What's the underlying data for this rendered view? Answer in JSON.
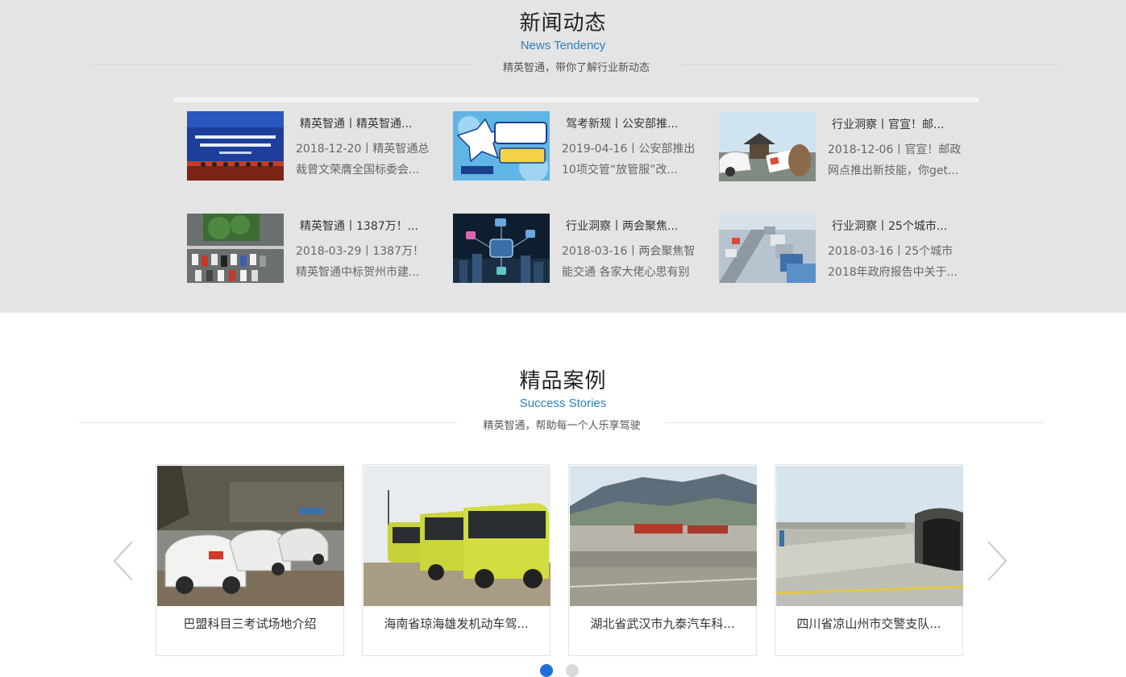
{
  "news": {
    "title": "新闻动态",
    "subtitle": "News Tendency",
    "tagline": "精英智通，带你了解行业新动态",
    "items": [
      {
        "title": "精英智通丨精英智通...",
        "line1": "2018-12-20丨精英智通总",
        "line2": "裁曾文荣膺全国标委会...",
        "thumb": "conference-photo"
      },
      {
        "title": "驾考新规丨公安部推...",
        "line1": "2019-04-16丨公安部推出",
        "line2": "10项交管“放管服”改...",
        "thumb": "policy-banner"
      },
      {
        "title": "行业洞察丨官宣！邮...",
        "line1": "2018-12-06丨官宣！邮政",
        "line2": "网点推出新技能，你get...",
        "thumb": "car-license-photo"
      },
      {
        "title": "精英智通丨1387万！...",
        "line1": "2018-03-29丨1387万！",
        "line2": "精英智通中标贺州市建...",
        "thumb": "parking-lot-photo"
      },
      {
        "title": "行业洞察丨两会聚焦...",
        "line1": "2018-03-16丨两会聚焦智",
        "line2": "能交通 各家大佬心思有别",
        "thumb": "smart-city-graphic"
      },
      {
        "title": "行业洞察丨25个城市...",
        "line1": "2018-03-16丨25个城市",
        "line2": "2018年政府报告中关于...",
        "thumb": "traffic-jam-photo"
      }
    ]
  },
  "cases": {
    "title": "精品案例",
    "subtitle": "Success Stories",
    "tagline": "精英智通，帮助每一个人乐享驾驶",
    "items": [
      {
        "label": "巴盟科目三考试场地介绍",
        "thumb": "training-cars-photo"
      },
      {
        "label": "海南省琼海雄发机动车驾...",
        "thumb": "buses-photo"
      },
      {
        "label": "湖北省武汉市九泰汽车科...",
        "thumb": "test-ground-photo"
      },
      {
        "label": "四川省凉山州市交警支队...",
        "thumb": "tunnel-track-photo"
      }
    ],
    "prev_icon": "chevron-left-icon",
    "next_icon": "chevron-right-icon",
    "pagination": {
      "pages": 2,
      "current": 1
    }
  },
  "colors": {
    "accent": "#2a7fc2",
    "dot_active": "#1e6fd9",
    "dot_inactive": "#d9d9d9",
    "news_bg": "#e4e4e4"
  }
}
